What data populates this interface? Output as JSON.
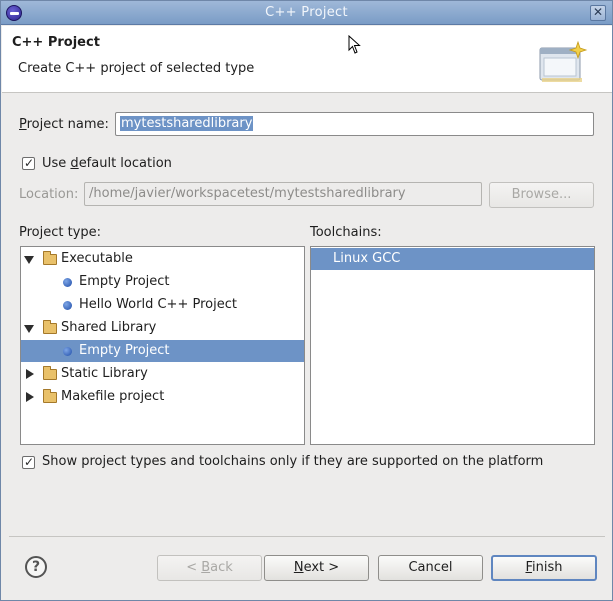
{
  "window": {
    "title": "C++ Project",
    "close_glyph": "✕"
  },
  "header": {
    "title": "C++ Project",
    "description": "Create C++ project of selected type"
  },
  "form": {
    "project_name": {
      "label_mnemonic": "P",
      "label_rest": "roject name:",
      "value": "mytestsharedlibrary"
    },
    "use_default_location": {
      "checked": true,
      "label_before": "Use ",
      "label_mnemonic": "d",
      "label_after": "efault location"
    },
    "location": {
      "label": "Location:",
      "value": "/home/javier/workspacetest/mytestsharedlibrary",
      "browse_label": "Browse..."
    }
  },
  "project_types": {
    "label": "Project type:",
    "items": [
      {
        "label": "Executable",
        "kind": "folder",
        "expanded": true
      },
      {
        "label": "Empty Project",
        "kind": "item"
      },
      {
        "label": "Hello World C++ Project",
        "kind": "item"
      },
      {
        "label": "Shared Library",
        "kind": "folder",
        "expanded": true
      },
      {
        "label": "Empty Project",
        "kind": "item",
        "selected": true
      },
      {
        "label": "Static Library",
        "kind": "folder",
        "expanded": false
      },
      {
        "label": "Makefile project",
        "kind": "folder",
        "expanded": false
      }
    ]
  },
  "toolchains": {
    "label": "Toolchains:",
    "items": [
      {
        "label": "Linux GCC",
        "selected": true
      }
    ]
  },
  "filter_checkbox": {
    "checked": true,
    "label": "Show project types and toolchains only if they are supported on the platform"
  },
  "buttons": {
    "help": "?",
    "back_prefix": "< ",
    "back_mnemonic": "B",
    "back_rest": "ack",
    "next_mnemonic": "N",
    "next_rest": "ext >",
    "cancel": "Cancel",
    "finish_mnemonic": "F",
    "finish_rest": "inish"
  },
  "colors": {
    "selection": "#6d93c6",
    "titlebar": "#7a9cc6"
  }
}
